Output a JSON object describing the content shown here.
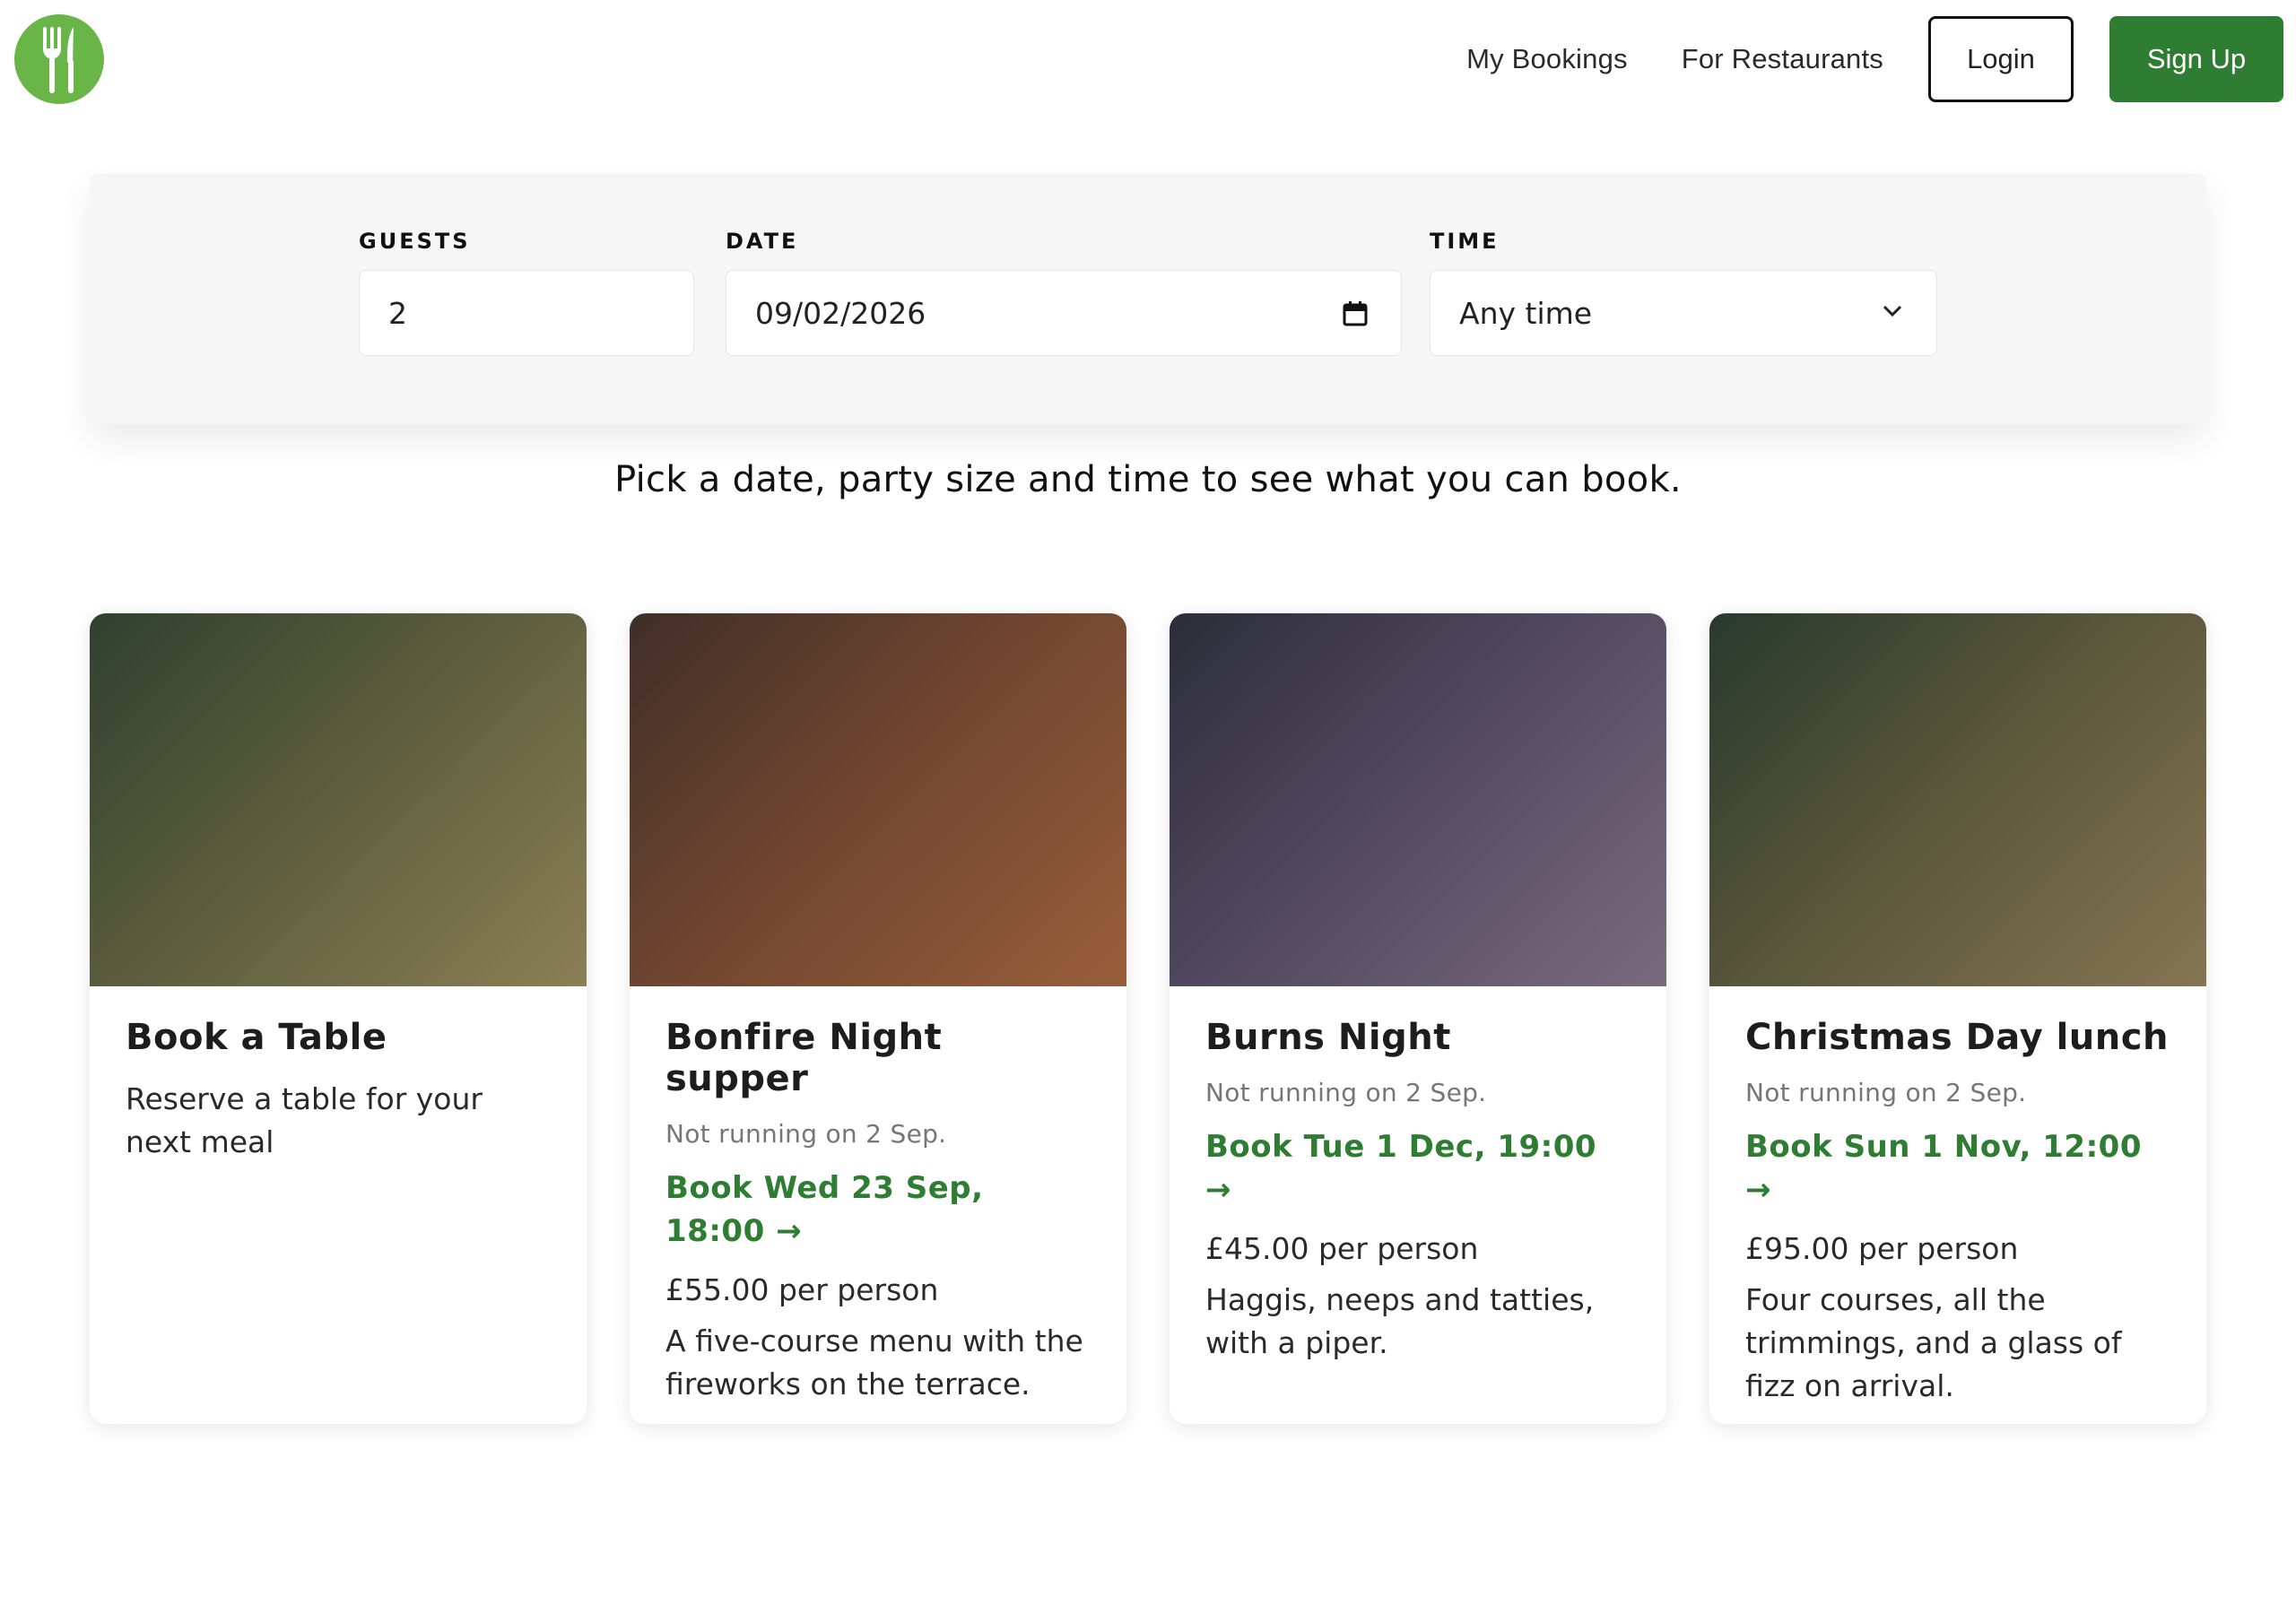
{
  "header": {
    "logo_icon": "fork-knife-icon",
    "nav": {
      "my_bookings": "My Bookings",
      "for_restaurants": "For Restaurants",
      "login": "Login",
      "sign_up": "Sign Up"
    }
  },
  "search": {
    "guests": {
      "label": "GUESTS",
      "value": "2"
    },
    "date": {
      "label": "DATE",
      "value": "09/02/2026"
    },
    "time": {
      "label": "TIME",
      "value": "Any time"
    }
  },
  "hint": "Pick a date, party size and time to see what you can book.",
  "cards": [
    {
      "title": "Book a Table",
      "description": "Reserve a table for your next meal"
    },
    {
      "title": "Bonfire Night supper",
      "note": "Not running on 2 Sep.",
      "link": "Book Wed 23 Sep, 18:00 →",
      "price": "£55.00 per person",
      "description": "A five-course menu with the fireworks on the terrace."
    },
    {
      "title": "Burns Night",
      "note": "Not running on 2 Sep.",
      "link": "Book Tue 1 Dec, 19:00 →",
      "price": "£45.00 per person",
      "description": "Haggis, neeps and tatties, with a piper."
    },
    {
      "title": "Christmas Day lunch",
      "note": "Not running on 2 Sep.",
      "link": "Book Sun 1 Nov, 12:00 →",
      "price": "£95.00 per person",
      "description": "Four courses, all the trimmings, and a glass of fizz on arrival."
    }
  ],
  "colors": {
    "brand_green": "#2e7d32",
    "logo_green": "#6ab547"
  }
}
